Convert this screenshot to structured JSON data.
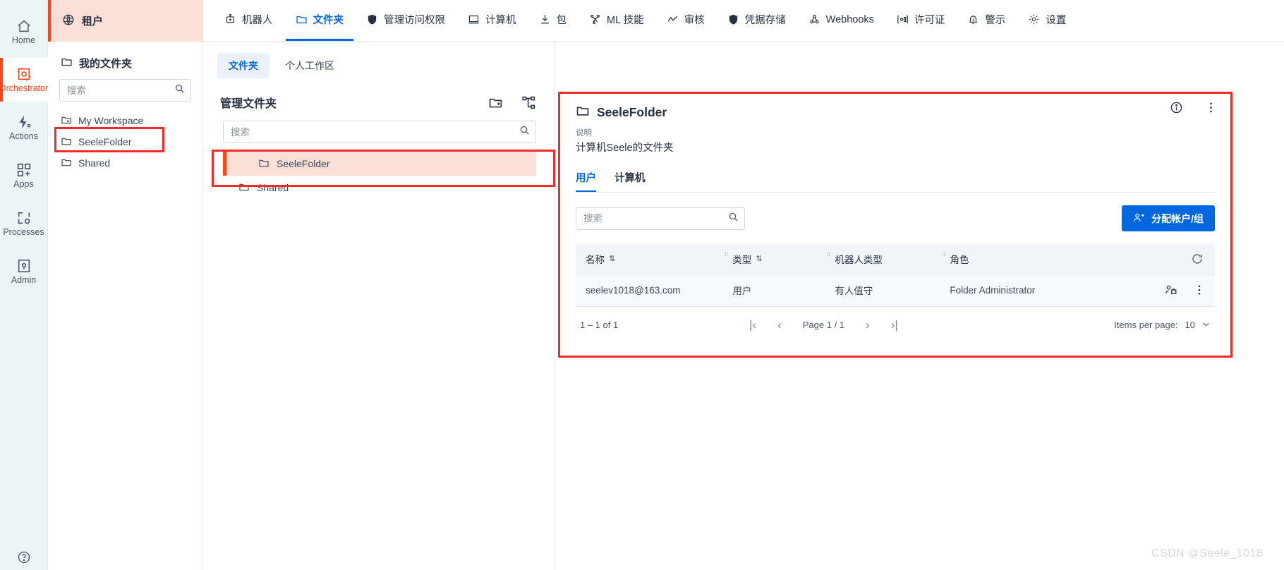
{
  "rail": {
    "items": [
      {
        "label": "Home",
        "icon": "home-icon",
        "active": false
      },
      {
        "label": "Orchestrator",
        "icon": "orchestrator-icon",
        "active": true
      },
      {
        "label": "Actions",
        "icon": "actions-icon",
        "active": false
      },
      {
        "label": "Apps",
        "icon": "apps-icon",
        "active": false
      },
      {
        "label": "Processes",
        "icon": "processes-icon",
        "active": false
      },
      {
        "label": "Admin",
        "icon": "admin-icon",
        "active": false
      }
    ]
  },
  "tenant": {
    "label": "租户",
    "icon": "globe-icon"
  },
  "my_folders": {
    "title": "我的文件夹",
    "search_placeholder": "搜索",
    "search_value": "",
    "items": [
      {
        "label": "My Workspace",
        "icon": "workspace-folder-icon",
        "highlighted": false
      },
      {
        "label": "SeeleFolder",
        "icon": "folder-icon",
        "highlighted": true
      },
      {
        "label": "Shared",
        "icon": "folder-icon",
        "highlighted": false
      }
    ]
  },
  "topnav": {
    "tabs": [
      {
        "label": "机器人",
        "icon": "robot-icon",
        "active": false
      },
      {
        "label": "文件夹",
        "icon": "folder-icon",
        "active": true
      },
      {
        "label": "管理访问权限",
        "icon": "shield-icon",
        "active": false
      },
      {
        "label": "计算机",
        "icon": "monitor-icon",
        "active": false
      },
      {
        "label": "包",
        "icon": "download-icon",
        "active": false
      },
      {
        "label": "ML 技能",
        "icon": "ml-skill-icon",
        "active": false
      },
      {
        "label": "审核",
        "icon": "audit-icon",
        "active": false
      },
      {
        "label": "凭据存储",
        "icon": "credential-shield-icon",
        "active": false
      },
      {
        "label": "Webhooks",
        "icon": "webhook-icon",
        "active": false
      },
      {
        "label": "许可证",
        "icon": "license-icon",
        "active": false
      },
      {
        "label": "警示",
        "icon": "bell-icon",
        "active": false
      },
      {
        "label": "设置",
        "icon": "gear-icon",
        "active": false
      }
    ]
  },
  "segmented": {
    "tabs": [
      {
        "label": "文件夹",
        "active": true
      },
      {
        "label": "个人工作区",
        "active": false
      }
    ]
  },
  "manage_folders": {
    "title": "管理文件夹",
    "add_folder_icon": "add-folder-icon",
    "hierarchy_icon": "hierarchy-icon",
    "search_placeholder": "搜索",
    "search_value": "",
    "items": [
      {
        "label": "SeeleFolder",
        "selected": true
      },
      {
        "label": "Shared",
        "selected": false
      }
    ]
  },
  "detail": {
    "title": "SeeleFolder",
    "title_icon": "folder-icon",
    "description_label": "说明",
    "description_value": "计算机Seele的文件夹",
    "info_icon": "info-icon",
    "more_icon": "kebab-menu-icon",
    "tabs": [
      {
        "label": "用户",
        "active": true
      },
      {
        "label": "计算机",
        "active": false
      }
    ],
    "search_placeholder": "搜索",
    "search_value": "",
    "assign_button": {
      "label": "分配帐户/组",
      "icon": "assign-user-icon"
    },
    "refresh_icon": "refresh-icon",
    "table": {
      "columns": [
        {
          "label": "名称",
          "sortable": true
        },
        {
          "label": "类型",
          "sortable": true
        },
        {
          "label": "机器人类型",
          "sortable": false
        },
        {
          "label": "角色",
          "sortable": false
        }
      ],
      "rows": [
        {
          "name": "seelev1018@163.com",
          "type": "用户",
          "robot_type": "有人值守",
          "role": "Folder Administrator",
          "actions": [
            "edit-user-icon",
            "kebab-menu-icon"
          ]
        }
      ]
    },
    "pager": {
      "range_text": "1 – 1 of 1",
      "first_label": "|‹",
      "prev_label": "‹",
      "page_label": "Page 1 / 1",
      "next_label": "›",
      "last_label": "›|",
      "items_per_page_label": "Items per page:",
      "items_per_page_value": "10"
    }
  },
  "watermark": "CSDN @Seele_1018",
  "colors": {
    "accent_orange": "#fa4616",
    "accent_blue": "#0067df",
    "highlight_red": "#ef2c2c",
    "tenant_bg": "#fbdfd6"
  }
}
